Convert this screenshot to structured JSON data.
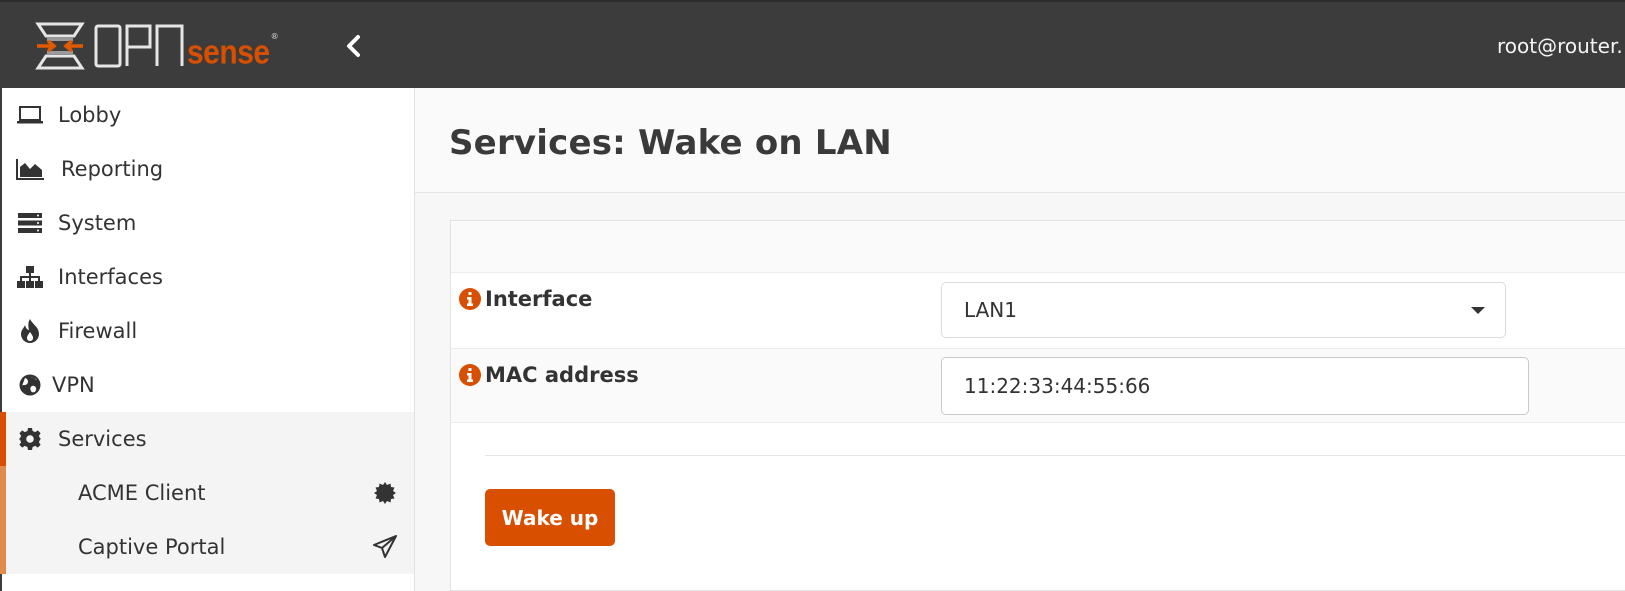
{
  "header": {
    "logo_text_main": "OPN",
    "logo_text_accent": "sense",
    "logo_registered": "®",
    "collapse_icon": "chevron-left-icon",
    "user": "root@router."
  },
  "colors": {
    "brand_orange": "#d94f00",
    "brand_orange_light": "#e08a4e",
    "topbar_bg": "#3c3c3c"
  },
  "sidebar": {
    "items": [
      {
        "label": "Lobby",
        "icon": "laptop-icon"
      },
      {
        "label": "Reporting",
        "icon": "area-chart-icon"
      },
      {
        "label": "System",
        "icon": "server-icon"
      },
      {
        "label": "Interfaces",
        "icon": "sitemap-icon"
      },
      {
        "label": "Firewall",
        "icon": "fire-icon"
      },
      {
        "label": "VPN",
        "icon": "globe-icon"
      },
      {
        "label": "Services",
        "icon": "gear-icon",
        "active": true
      }
    ],
    "subitems": [
      {
        "label": "ACME Client",
        "icon": "certificate-icon"
      },
      {
        "label": "Captive Portal",
        "icon": "paper-plane-icon"
      }
    ]
  },
  "main": {
    "title": "Services: Wake on LAN",
    "form": {
      "interface": {
        "label": "Interface",
        "value": "LAN1"
      },
      "mac": {
        "label": "MAC address",
        "value": "11:22:33:44:55:66"
      }
    },
    "wake_button": "Wake up"
  }
}
